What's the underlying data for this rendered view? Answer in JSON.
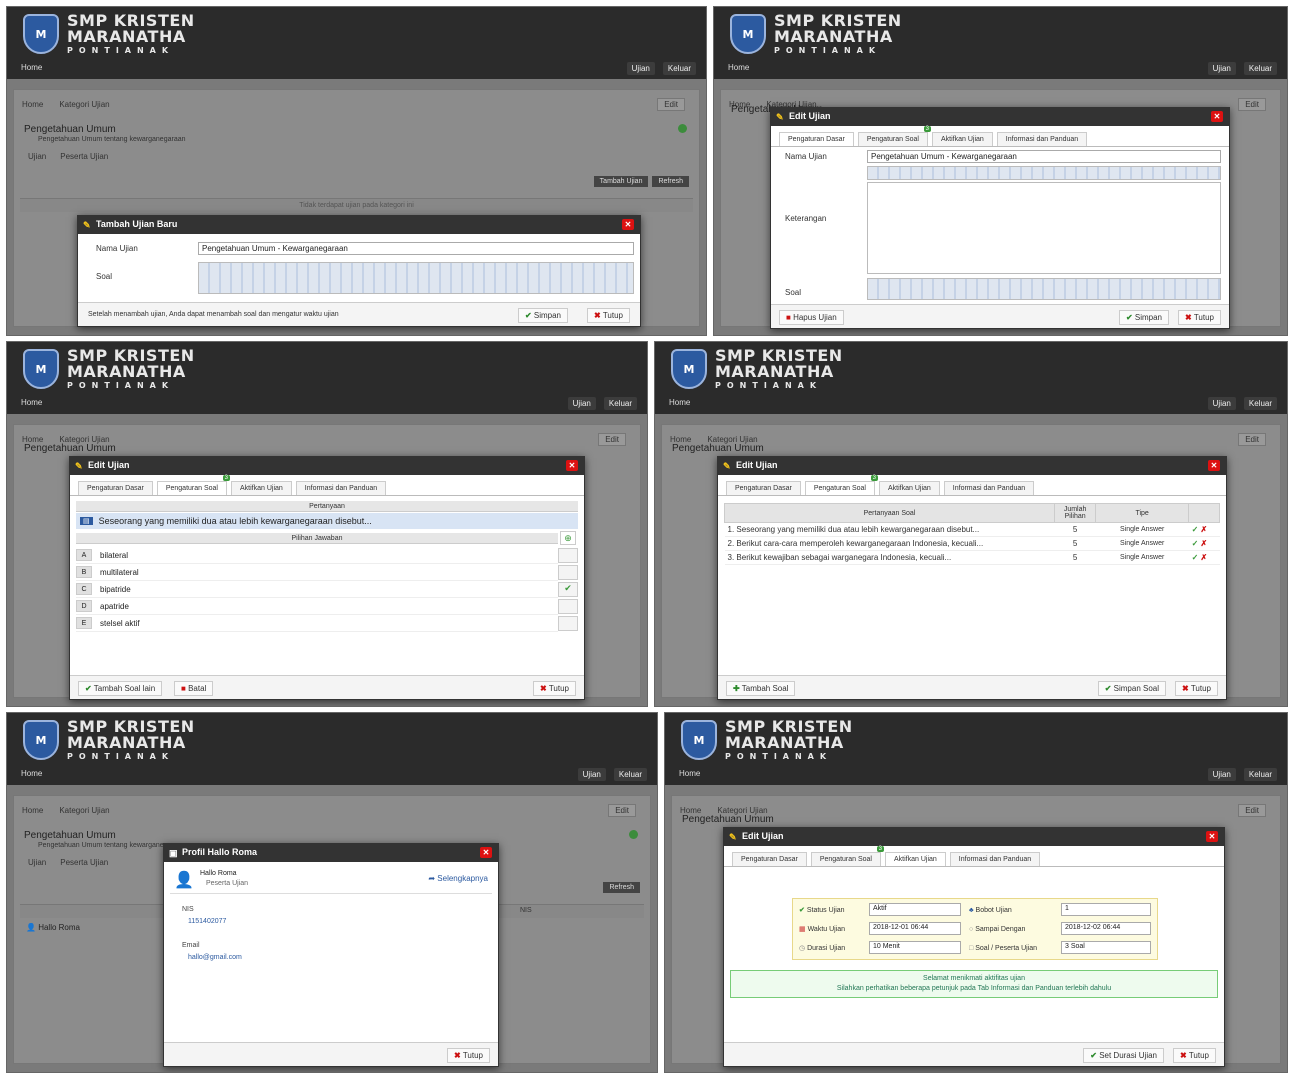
{
  "brand": {
    "line1": "SMP KRISTEN",
    "line2": "MARANATHA",
    "line3": "PONTIANAK",
    "shield_text": "M"
  },
  "nav": {
    "home": "Home",
    "ujian": "Ujian",
    "keluar": "Keluar"
  },
  "course": {
    "crumb_home": "Home",
    "crumb_category": "Kategori Ujian",
    "edit": "Edit",
    "title": "Pengetahuan Umum",
    "subtitle": "Pengetahuan Umum tentang kewarganegaraan",
    "tab_ujian": "Ujian",
    "tab_peserta": "Peserta Ujian",
    "btn_tambah": "Tambah Ujian",
    "btn_refresh": "Refresh",
    "empty_hint": "Tidak terdapat ujian pada kategori ini"
  },
  "tambah": {
    "title": "Tambah Ujian Baru",
    "nama_label": "Nama Ujian",
    "nama_value": "Pengetahuan Umum - Kewarganegaraan",
    "soal_label": "Soal",
    "note": "Setelah menambah ujian, Anda dapat menambah soal dan mengatur waktu ujian",
    "simpan": "Simpan",
    "tutup": "Tutup"
  },
  "edit": {
    "title": "Edit Ujian",
    "tab_dasar": "Pengaturan Dasar",
    "tab_soal": "Pengaturan Soal",
    "tab_aktifkan": "Aktifkan Ujian",
    "tab_info": "Informasi dan Panduan",
    "badge": "3",
    "nama_label": "Nama Ujian",
    "nama_value": "Pengetahuan Umum - Kewarganegaraan",
    "keterangan_label": "Keterangan",
    "soal_label": "Soal",
    "hapus": "Hapus Ujian",
    "simpan": "Simpan",
    "tutup": "Tutup"
  },
  "soal": {
    "pertanyaan_header": "Pertanyaan",
    "pertanyaan": "Seseorang yang memiliki dua atau lebih kewarganegaraan disebut...",
    "pilihan_header": "Pilihan Jawaban",
    "options": [
      {
        "key": "A",
        "text": "bilateral"
      },
      {
        "key": "B",
        "text": "multilateral"
      },
      {
        "key": "C",
        "text": "bipatride"
      },
      {
        "key": "D",
        "text": "apatride"
      },
      {
        "key": "E",
        "text": "stelsel aktif"
      }
    ],
    "tambah_soal_lain": "Tambah Soal lain",
    "batal": "Batal",
    "tutup": "Tutup"
  },
  "daftar": {
    "col_q": "Pertanyaan Soal",
    "col_n": "Jumlah Pilihan",
    "col_t": "Tipe",
    "rows": [
      {
        "no": "1",
        "q": "Seseorang yang memiliki dua atau lebih kewarganegaraan disebut...",
        "n": "5",
        "t": "Single Answer"
      },
      {
        "no": "2",
        "q": "Berikut cara-cara memperoleh kewarganegaraan Indonesia, kecuali...",
        "n": "5",
        "t": "Single Answer"
      },
      {
        "no": "3",
        "q": "Berikut kewajiban sebagai warganegara Indonesia, kecuali...",
        "n": "5",
        "t": "Single Answer"
      }
    ],
    "tambah": "Tambah Soal",
    "simpan": "Simpan Soal",
    "tutup": "Tutup"
  },
  "profil": {
    "title": "Profil Hallo Roma",
    "name": "Hallo Roma",
    "role": "Peserta Ujian",
    "selengkapnya": "Selengkapnya",
    "nisn_label": "NIS",
    "nisn_value": "1151402077",
    "email_label": "Email",
    "email_value": "hallo@gmail.com",
    "tutup": "Tutup",
    "list_name": "Hallo Roma",
    "col_nis": "NIS"
  },
  "aktif": {
    "status_label": "Status Ujian",
    "status_value": "Aktif",
    "bobot_label": "Bobot Ujian",
    "bobot_value": "1",
    "mulai_label": "Waktu Ujian",
    "mulai_value": "2018-12-01 06:44",
    "sampai_label": "Sampai Dengan",
    "sampai_value": "2018-12-02 06:44",
    "durasi_label": "Durasi Ujian",
    "durasi_value": "10 Menit",
    "soal_label": "Soal / Peserta Ujian",
    "soal_value": "3 Soal",
    "info1": "Selamat menikmati aktifitas ujian",
    "info2": "Silahkan perhatikan beberapa petunjuk pada Tab Informasi dan Panduan terlebih dahulu",
    "set_durasi": "Set Durasi Ujian",
    "tutup": "Tutup"
  }
}
